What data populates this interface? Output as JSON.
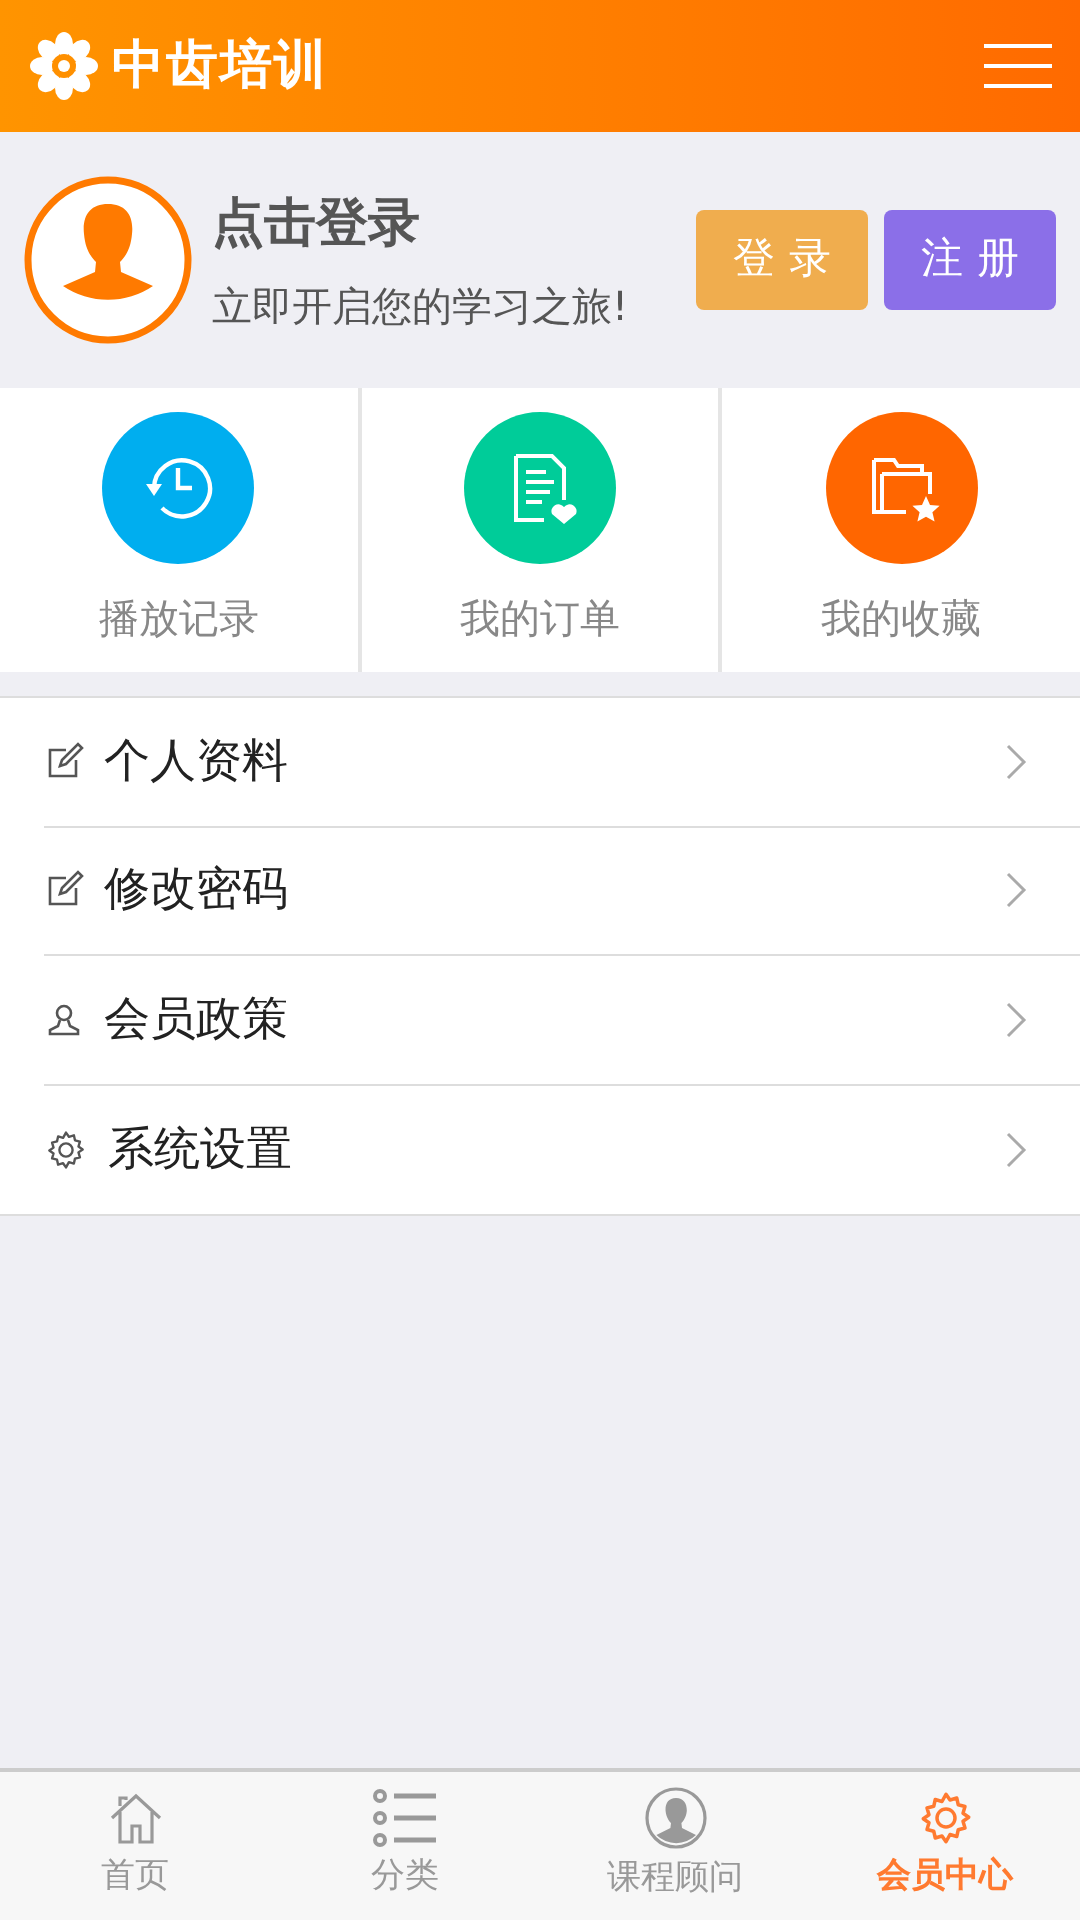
{
  "header": {
    "logo_text": "中齿培训"
  },
  "profile": {
    "title": "点击登录",
    "subtitle": "立即开启您的学习之旅!",
    "buttons": [
      {
        "label": "登 录",
        "kind": "login"
      },
      {
        "label": "注 册",
        "kind": "register"
      }
    ]
  },
  "shortcuts": [
    {
      "label": "播放记录",
      "kind": "history",
      "color": "#00aeef"
    },
    {
      "label": "我的订单",
      "kind": "order",
      "color": "#00cc99"
    },
    {
      "label": "我的收藏",
      "kind": "favorite",
      "color": "#ff6600"
    }
  ],
  "menu": [
    {
      "label": "个人资料",
      "kind": "edit"
    },
    {
      "label": "修改密码",
      "kind": "edit"
    },
    {
      "label": "会员政策",
      "kind": "user"
    },
    {
      "label": "系统设置",
      "kind": "gear"
    }
  ],
  "tabbar": [
    {
      "label": "首页",
      "kind": "home",
      "selected": false
    },
    {
      "label": "分类",
      "kind": "list",
      "selected": false
    },
    {
      "label": "课程顾问",
      "kind": "person",
      "selected": false
    },
    {
      "label": "会员中心",
      "kind": "gear",
      "selected": true
    }
  ]
}
